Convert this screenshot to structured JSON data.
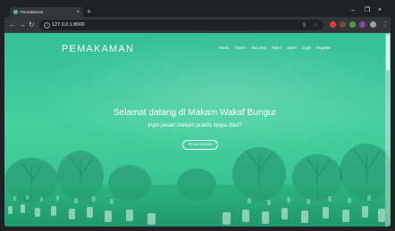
{
  "browser": {
    "tab_title": "Pemakaman",
    "tab_close": "×",
    "new_tab": "+",
    "url": "127.0.0.1:8000",
    "window_controls": {
      "minimize": "–",
      "maximize": "❐",
      "close": "×"
    },
    "nav": {
      "back": "←",
      "forward": "→",
      "reload": "↻"
    }
  },
  "site": {
    "brand": "PEMAKAMAN",
    "nav_items": [
      "Home",
      "Tujuan",
      "Tata cara",
      "Paket",
      "Galeri",
      "Login",
      "Register"
    ]
  },
  "hero": {
    "title": "Selamat datang di Makam Wakaf Bungur",
    "subtitle": "Ingin pesan makam praktis tanpa ribet?",
    "button_label": "PESAN MAKAM"
  },
  "colors": {
    "overlay": "#3bc79a",
    "text": "#ffffff"
  }
}
